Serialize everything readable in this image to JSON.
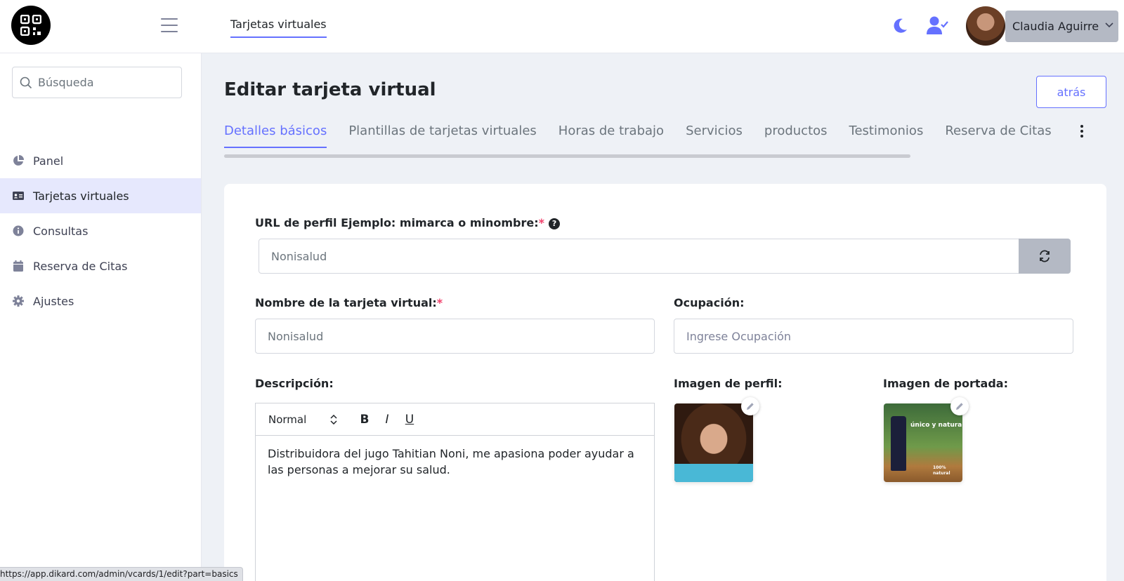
{
  "header": {
    "top_tab": "Tarjetas virtuales",
    "user_name": "Claudia Aguirre"
  },
  "sidebar": {
    "search_placeholder": "Búsqueda",
    "items": [
      {
        "label": "Panel",
        "icon": "chart-pie-icon",
        "active": false
      },
      {
        "label": "Tarjetas virtuales",
        "icon": "id-card-icon",
        "active": true
      },
      {
        "label": "Consultas",
        "icon": "info-circle-icon",
        "active": false
      },
      {
        "label": "Reserva de Citas",
        "icon": "calendar-icon",
        "active": false
      },
      {
        "label": "Ajustes",
        "icon": "gear-icon",
        "active": false
      }
    ]
  },
  "main": {
    "title": "Editar tarjeta virtual",
    "back_label": "atrás",
    "tabs": [
      {
        "label": "Detalles básicos",
        "active": true
      },
      {
        "label": "Plantillas de tarjetas virtuales"
      },
      {
        "label": "Horas de trabajo"
      },
      {
        "label": "Servicios"
      },
      {
        "label": "productos"
      },
      {
        "label": "Testimonios"
      },
      {
        "label": "Reserva de Citas"
      }
    ]
  },
  "form": {
    "url_label": "URL de perfil Ejemplo: mimarca o minombre:",
    "url_value": "Nonisalud",
    "name_label": "Nombre de la tarjeta virtual:",
    "name_value": "Nonisalud",
    "occupation_label": "Ocupación:",
    "occupation_placeholder": "Ingrese Ocupación",
    "description_label": "Descripción:",
    "format_value": "Normal",
    "bold_label": "B",
    "italic_label": "I",
    "underline_label": "U",
    "description_text": "Distribuidora del jugo Tahitian Noni, me apasiona poder ayudar a las personas a mejorar su salud.",
    "profile_image_label": "Imagen de perfil:",
    "cover_image_label": "Imagen de portada:",
    "cover_text_1": "único y natural",
    "cover_text_2": "100% natural"
  },
  "status_bar": {
    "url": "https://app.dikard.com/admin/vcards/1/edit?part=basics"
  },
  "colors": {
    "accent": "#6571ff",
    "required": "#f1416c",
    "sidebar_active": "#e6e8fd"
  }
}
